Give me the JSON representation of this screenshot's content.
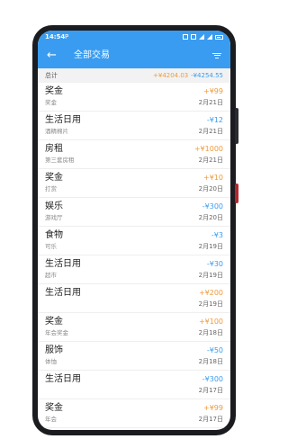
{
  "status": {
    "time": "14:54",
    "left_icon": "P"
  },
  "header": {
    "title": "全部交易"
  },
  "summary": {
    "label": "总计",
    "income": "+¥4204.03",
    "expense": "-¥4254.55"
  },
  "transactions": [
    {
      "category": "奖金",
      "note": "奖金",
      "amount": "+¥99",
      "type": "income",
      "date": "2月21日"
    },
    {
      "category": "生活日用",
      "note": "酒精棉片",
      "amount": "-¥12",
      "type": "expense",
      "date": "2月21日"
    },
    {
      "category": "房租",
      "note": "第三套房租",
      "amount": "+¥1000",
      "type": "income",
      "date": "2月21日"
    },
    {
      "category": "奖金",
      "note": "打赏",
      "amount": "+¥10",
      "type": "income",
      "date": "2月20日"
    },
    {
      "category": "娱乐",
      "note": "游戏厅",
      "amount": "-¥300",
      "type": "expense",
      "date": "2月20日"
    },
    {
      "category": "食物",
      "note": "可乐",
      "amount": "-¥3",
      "type": "expense",
      "date": "2月19日"
    },
    {
      "category": "生活日用",
      "note": "超市",
      "amount": "-¥30",
      "type": "expense",
      "date": "2月19日"
    },
    {
      "category": "生活日用",
      "note": "",
      "amount": "+¥200",
      "type": "income",
      "date": "2月19日"
    },
    {
      "category": "奖金",
      "note": "年会奖金",
      "amount": "+¥100",
      "type": "income",
      "date": "2月18日"
    },
    {
      "category": "服饰",
      "note": "体恤",
      "amount": "-¥50",
      "type": "expense",
      "date": "2月18日"
    },
    {
      "category": "生活日用",
      "note": "",
      "amount": "-¥300",
      "type": "expense",
      "date": "2月17日"
    },
    {
      "category": "奖金",
      "note": "年会",
      "amount": "+¥99",
      "type": "income",
      "date": "2月17日"
    }
  ]
}
